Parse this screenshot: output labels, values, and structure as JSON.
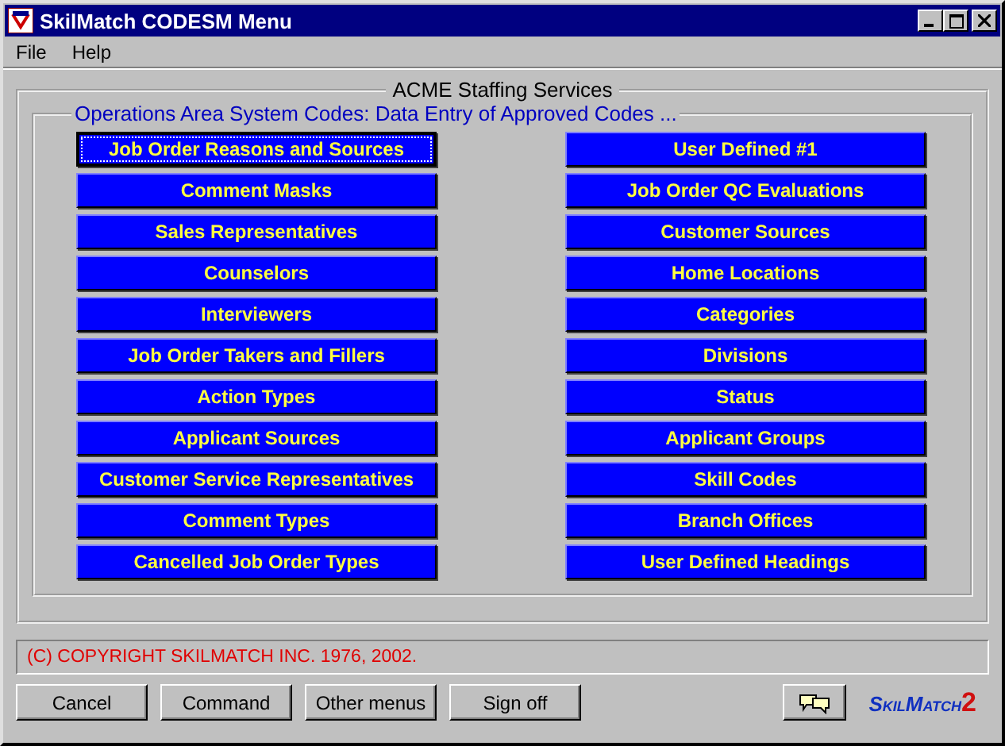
{
  "window": {
    "title": "SkilMatch CODESM Menu"
  },
  "menu": [
    "File",
    "Help"
  ],
  "outer_group": {
    "title": "ACME Staffing Services"
  },
  "inner_group": {
    "title": "Operations Area System Codes:  Data Entry of Approved Codes ..."
  },
  "left_buttons": [
    {
      "label": "Job Order Reasons and Sources",
      "focused": true
    },
    {
      "label": "Comment Masks",
      "focused": false
    },
    {
      "label": "Sales Representatives",
      "focused": false
    },
    {
      "label": "Counselors",
      "focused": false
    },
    {
      "label": "Interviewers",
      "focused": false
    },
    {
      "label": "Job Order Takers and Fillers",
      "focused": false
    },
    {
      "label": "Action Types",
      "focused": false
    },
    {
      "label": "Applicant Sources",
      "focused": false
    },
    {
      "label": "Customer Service Representatives",
      "focused": false
    },
    {
      "label": "Comment Types",
      "focused": false
    },
    {
      "label": "Cancelled Job Order Types",
      "focused": false
    }
  ],
  "right_buttons": [
    {
      "label": "User Defined #1",
      "focused": false
    },
    {
      "label": "Job Order QC Evaluations",
      "focused": false
    },
    {
      "label": "Customer Sources",
      "focused": false
    },
    {
      "label": "Home Locations",
      "focused": false
    },
    {
      "label": "Categories",
      "focused": false
    },
    {
      "label": "Divisions",
      "focused": false
    },
    {
      "label": "Status",
      "focused": false
    },
    {
      "label": "Applicant Groups",
      "focused": false
    },
    {
      "label": "Skill Codes",
      "focused": false
    },
    {
      "label": "Branch Offices",
      "focused": false
    },
    {
      "label": "User Defined Headings",
      "focused": false
    }
  ],
  "status_bar": "(C) COPYRIGHT SKILMATCH INC. 1976, 2002.",
  "bottom_buttons": [
    "Cancel",
    "Command",
    "Other menus",
    "Sign off"
  ],
  "logo": {
    "name": "SkilMatch",
    "version": "2"
  }
}
